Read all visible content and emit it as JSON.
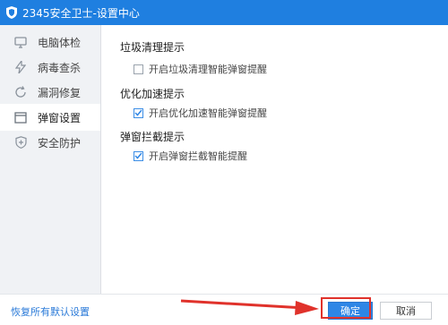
{
  "window": {
    "title": "2345安全卫士-设置中心"
  },
  "sidebar": {
    "items": [
      {
        "label": "电脑体检",
        "icon": "monitor-icon"
      },
      {
        "label": "病毒查杀",
        "icon": "lightning-icon"
      },
      {
        "label": "漏洞修复",
        "icon": "refresh-icon"
      },
      {
        "label": "弹窗设置",
        "icon": "window-icon",
        "active": true
      },
      {
        "label": "安全防护",
        "icon": "shield-plus-icon"
      }
    ]
  },
  "main": {
    "sections": [
      {
        "title": "垃圾清理提示",
        "option": "开启垃圾清理智能弹窗提醒",
        "checked": false
      },
      {
        "title": "优化加速提示",
        "option": "开启优化加速智能弹窗提醒",
        "checked": true
      },
      {
        "title": "弹窗拦截提示",
        "option": "开启弹窗拦截智能提醒",
        "checked": true
      }
    ]
  },
  "footer": {
    "restore_label": "恢复所有默认设置",
    "ok_label": "确定",
    "cancel_label": "取消"
  },
  "colors": {
    "titlebar": "#1f7fe0",
    "accent": "#2e86e6",
    "highlight": "#e0322b"
  }
}
